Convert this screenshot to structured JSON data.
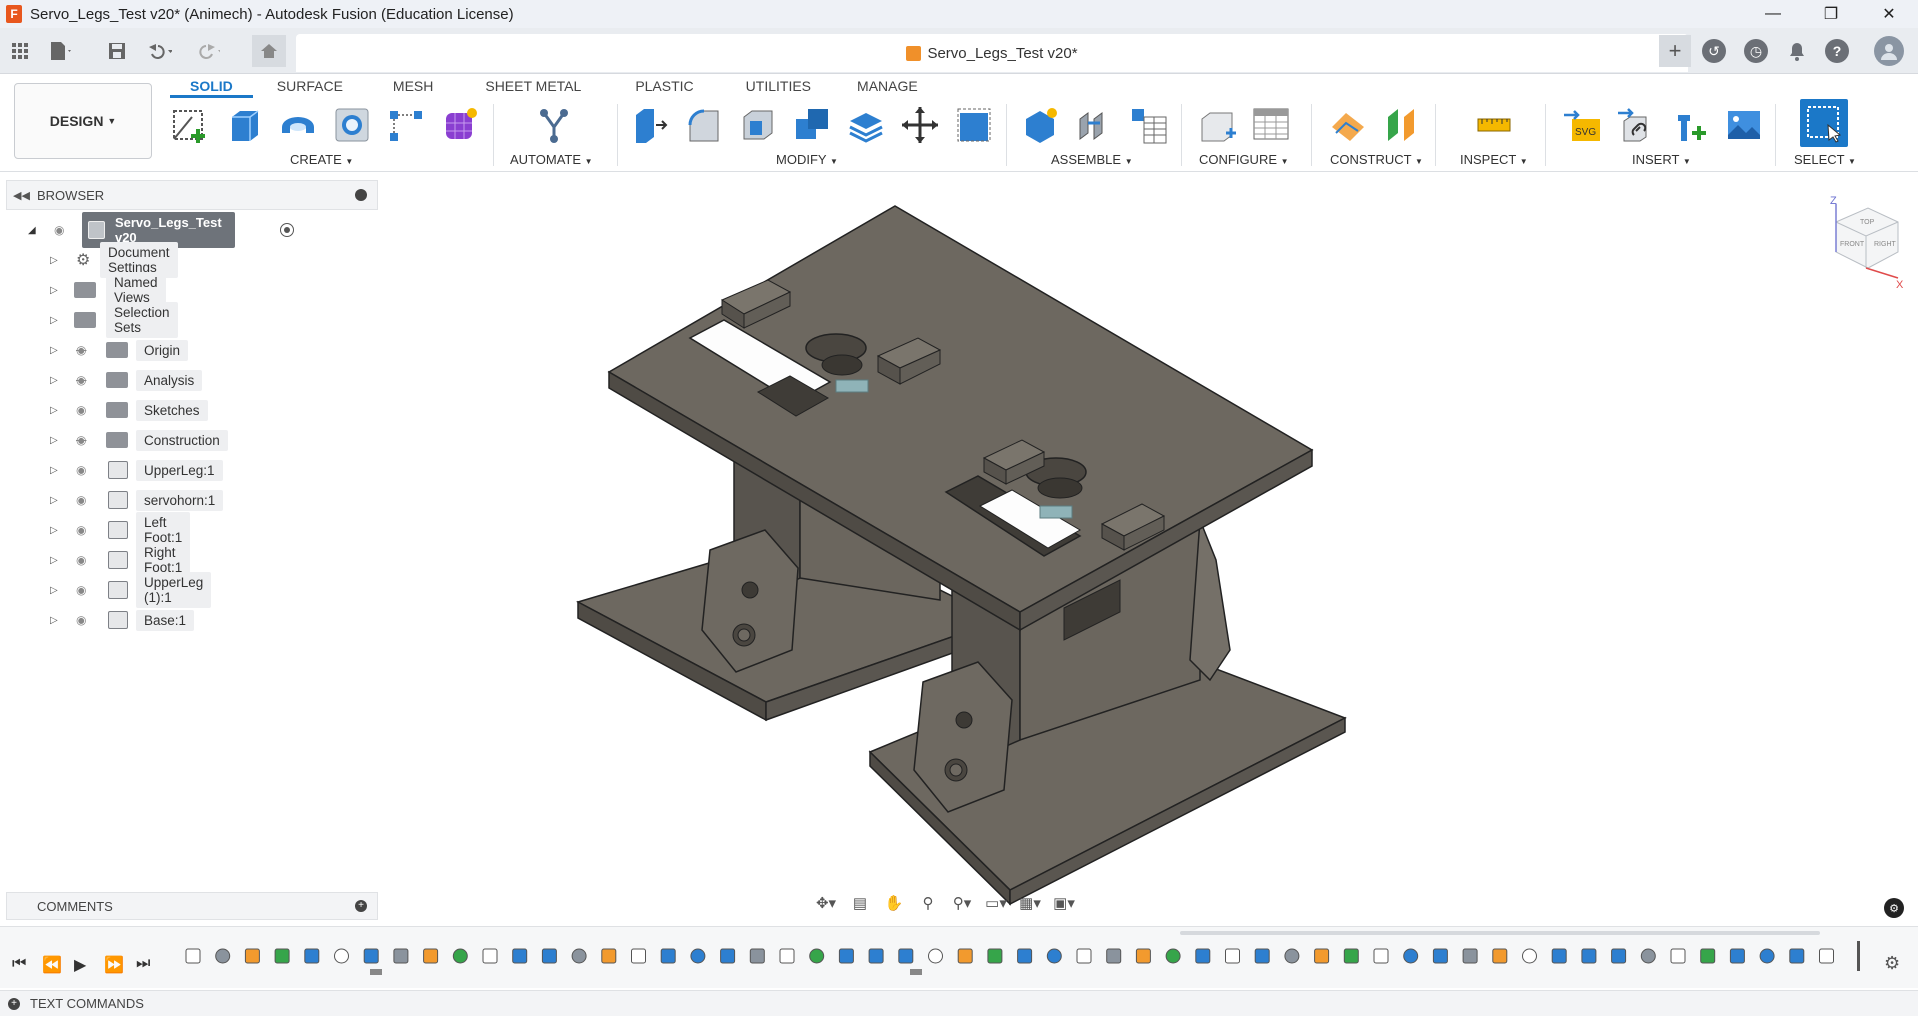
{
  "window": {
    "title": "Servo_Legs_Test v20* (Animech) - Autodesk Fusion (Education License)",
    "minimize": "—",
    "restore": "❐",
    "close": "✕",
    "logo": "F"
  },
  "document_tab": {
    "title": "Servo_Legs_Test v20*",
    "close": "✕"
  },
  "toolbar": {
    "workspace": "DESIGN",
    "tabs": [
      "SOLID",
      "SURFACE",
      "MESH",
      "SHEET METAL",
      "PLASTIC",
      "UTILITIES",
      "MANAGE"
    ],
    "groups": [
      "CREATE",
      "AUTOMATE",
      "MODIFY",
      "ASSEMBLE",
      "CONFIGURE",
      "CONSTRUCT",
      "INSPECT",
      "INSERT",
      "SELECT"
    ]
  },
  "browser": {
    "title": "BROWSER",
    "root": "Servo_Legs_Test v20",
    "items": [
      {
        "label": "Document Settings",
        "icon": "gear-icon"
      },
      {
        "label": "Named Views",
        "icon": "folder-icon"
      },
      {
        "label": "Selection Sets",
        "icon": "folder-icon"
      },
      {
        "label": "Origin",
        "icon": "folder-icon",
        "hidden": true
      },
      {
        "label": "Analysis",
        "icon": "folder-icon",
        "hidden": true
      },
      {
        "label": "Sketches",
        "icon": "folder-icon"
      },
      {
        "label": "Construction",
        "icon": "folder-icon",
        "hidden": true
      },
      {
        "label": "UpperLeg:1",
        "icon": "component-icon"
      },
      {
        "label": "servohorn:1",
        "icon": "component-icon"
      },
      {
        "label": "Left Foot:1",
        "icon": "component-icon"
      },
      {
        "label": "Right Foot:1",
        "icon": "component-icon"
      },
      {
        "label": "UpperLeg (1):1",
        "icon": "component-icon"
      },
      {
        "label": "Base:1",
        "icon": "component-icon"
      }
    ]
  },
  "viewcube": {
    "top": "TOP",
    "front": "FRONT",
    "right": "RIGHT",
    "z": "Z",
    "x": "X"
  },
  "comments": {
    "title": "COMMENTS"
  },
  "text_commands": {
    "title": "TEXT COMMANDS"
  },
  "colors": {
    "accent": "#1b78c8",
    "model": "#6d6860",
    "model_dark": "#4f4b45",
    "model_light": "#807a71"
  }
}
